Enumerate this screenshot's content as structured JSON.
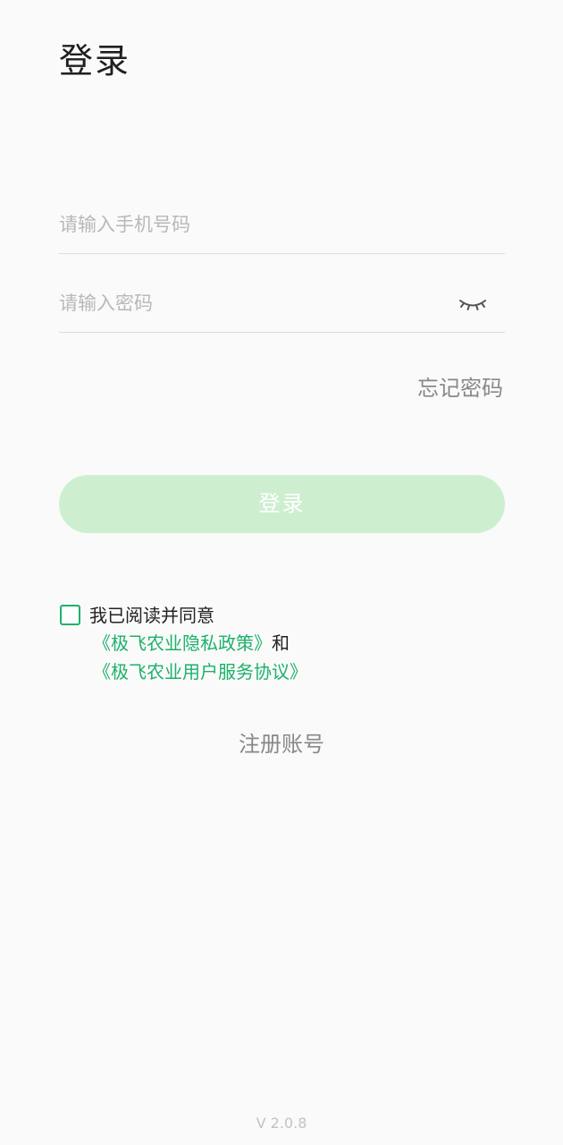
{
  "header": {
    "title": "登录"
  },
  "form": {
    "phone_placeholder": "请输入手机号码",
    "phone_value": "",
    "password_placeholder": "请输入密码",
    "password_value": "",
    "password_visibility_icon": "eye-closed-icon",
    "forgot_password_label": "忘记密码",
    "login_button_label": "登录"
  },
  "agreement": {
    "checked": false,
    "prefix": "我已阅读并同意",
    "privacy_policy_link": "《极飞农业隐私政策》",
    "conjunction": "和",
    "service_agreement_link": "《极飞农业用户服务协议》"
  },
  "register_label": "注册账号",
  "version_label": "V 2.0.8",
  "colors": {
    "accent": "#1db16a",
    "login_button_disabled": "#cdefd0",
    "background": "#fafafa",
    "muted_text": "#888888"
  }
}
